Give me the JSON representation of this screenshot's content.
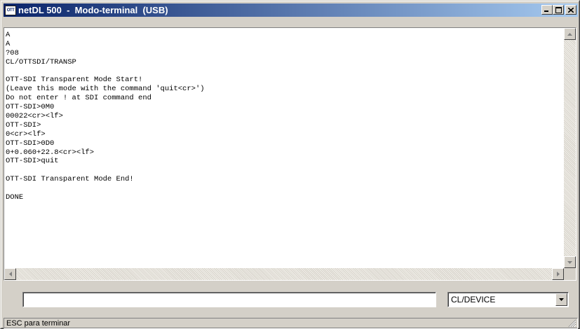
{
  "window": {
    "icon_label": "OTT",
    "title": "netDL 500  -  Modo-terminal  (USB)"
  },
  "terminal": {
    "lines": [
      "A",
      "A",
      "?08",
      "CL/OTTSDI/TRANSP",
      "",
      "OTT-SDI Transparent Mode Start!",
      "(Leave this mode with the command 'quit<cr>')",
      "Do not enter ! at SDI command end",
      "OTT-SDI>0M0",
      "00022<cr><lf>",
      "OTT-SDI>",
      "0<cr><lf>",
      "OTT-SDI>0D0",
      "0+0.060+22.8<cr><lf>",
      "OTT-SDI>quit",
      "",
      "OTT-SDI Transparent Mode End!",
      "",
      "DONE"
    ]
  },
  "command": {
    "input_value": "",
    "select_value": "CL/DEVICE"
  },
  "statusbar": {
    "text": "ESC para terminar"
  },
  "icons": {
    "minimize": "minimize-icon",
    "maximize": "maximize-icon",
    "close": "close-icon",
    "dropdown": "chevron-down-icon"
  }
}
